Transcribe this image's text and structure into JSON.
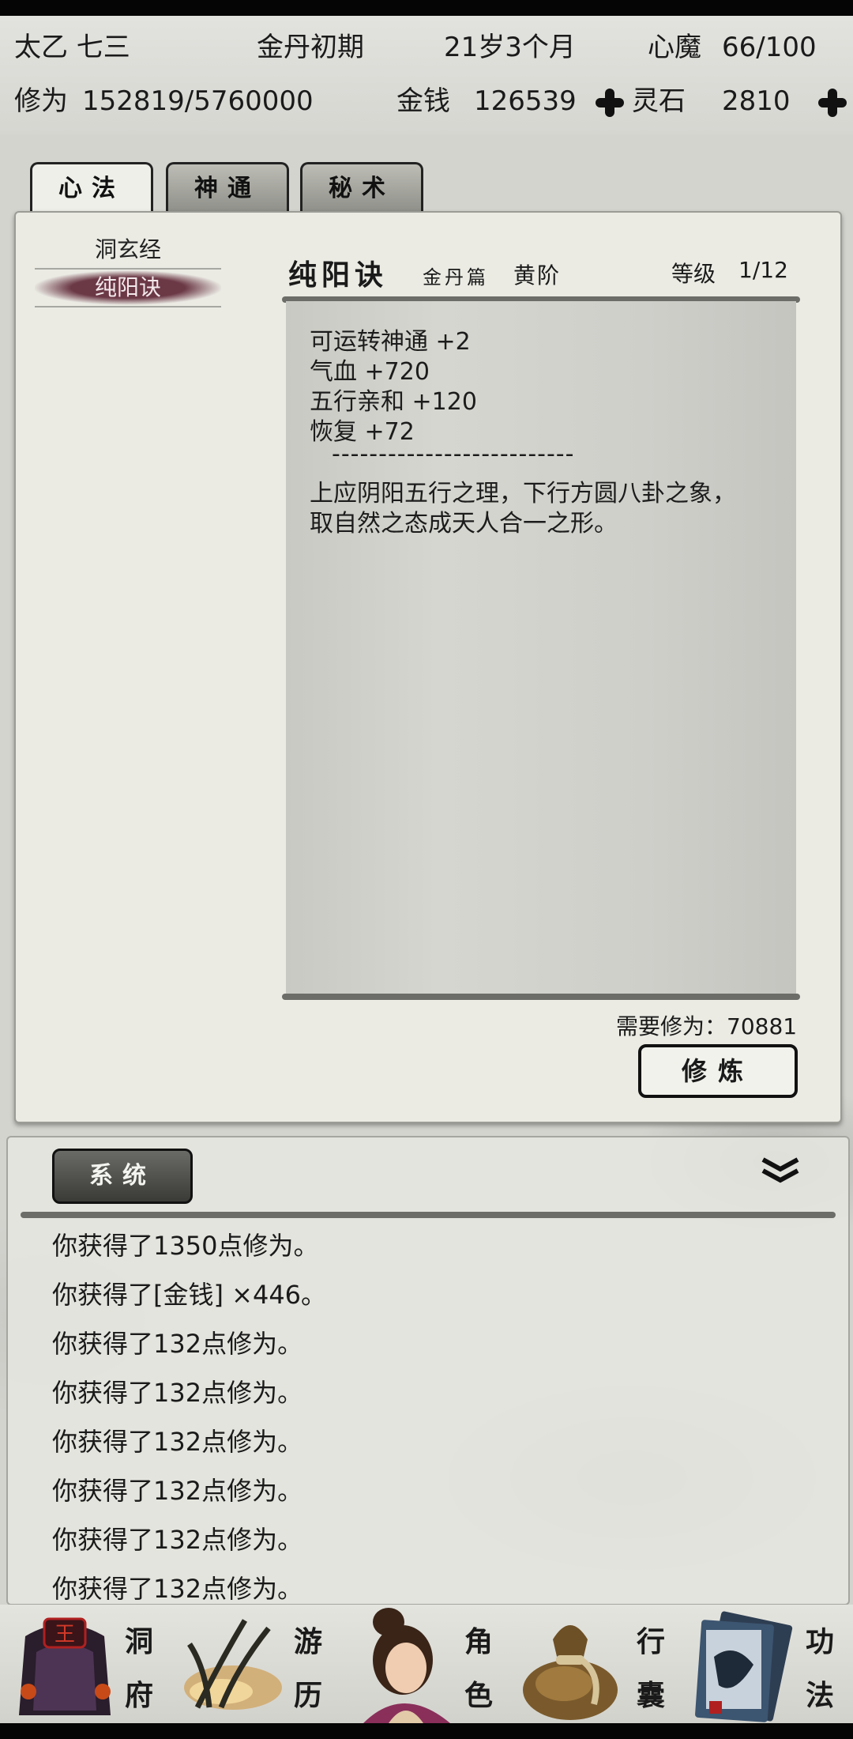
{
  "status": {
    "name": "太乙 七三",
    "realm": "金丹初期",
    "age": "21岁3个月",
    "demon_label": "心魔",
    "demon_value": "66/100",
    "cultivation_label": "修为",
    "cultivation_value": "152819/5760000",
    "money_label": "金钱",
    "money_value": "126539",
    "spirit_stone_label": "灵石",
    "spirit_stone_value": "2810"
  },
  "tabs": [
    {
      "label": "心法",
      "active": true
    },
    {
      "label": "神通",
      "active": false
    },
    {
      "label": "秘术",
      "active": false
    }
  ],
  "technique_list": [
    {
      "label": "洞玄经",
      "selected": false
    },
    {
      "label": "纯阳诀",
      "selected": true
    }
  ],
  "detail": {
    "title": "纯阳诀",
    "subtitle": "金丹篇",
    "rank": "黄阶",
    "level_label": "等级",
    "level_value": "1/12",
    "lines": [
      "可运转神通 +2",
      "气血 +720",
      "五行亲和 +120",
      "恢复 +72"
    ],
    "divider": "--------------------------",
    "description": [
      "上应阴阳五行之理，下行方圆八卦之象，",
      "取自然之态成天人合一之形。"
    ],
    "requirement": "需要修为：70881",
    "cultivate_button": "修炼"
  },
  "log": {
    "tab_label": "系统",
    "lines": [
      "你获得了1350点修为。",
      "你获得了[金钱] ×446。",
      "你获得了132点修为。",
      "你获得了132点修为。",
      "你获得了132点修为。",
      "你获得了132点修为。",
      "你获得了132点修为。",
      "你获得了132点修为。"
    ]
  },
  "nav": {
    "cave": [
      "洞",
      "府"
    ],
    "travel": [
      "游",
      "历"
    ],
    "character": [
      "角",
      "色"
    ],
    "bag": [
      "行",
      "囊"
    ],
    "skills": [
      "功",
      "法"
    ],
    "seal_char": "王"
  },
  "colors": {
    "selected_item": "#6b3846",
    "paper": "#ebebe4",
    "ink": "#1a1a1a"
  }
}
